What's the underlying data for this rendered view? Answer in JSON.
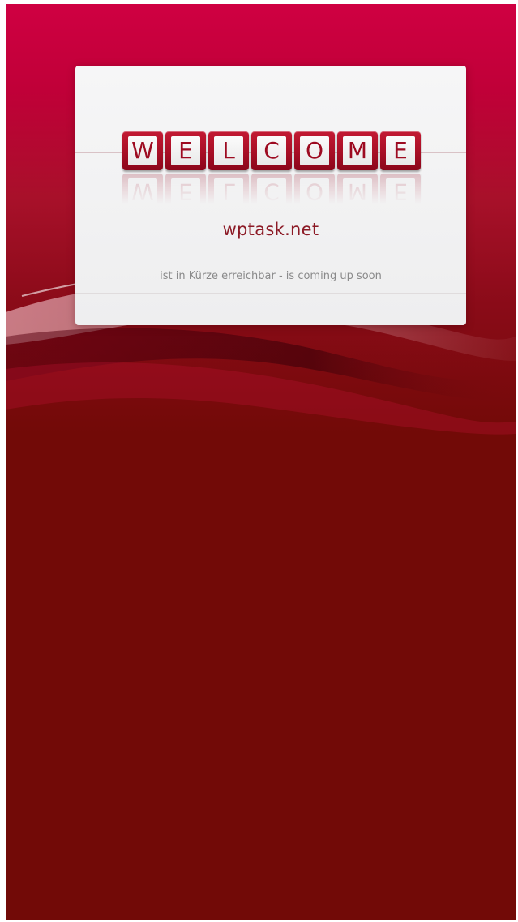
{
  "welcome": {
    "letters": [
      "W",
      "E",
      "L",
      "C",
      "O",
      "M",
      "E"
    ]
  },
  "site": {
    "name": "wptask.net",
    "tagline": "ist in Kürze erreichbar - is coming up soon"
  },
  "colors": {
    "top_background": "#cf0042",
    "bottom_background": "#720a07",
    "tile": "#a70e25",
    "site_name": "#8c1a26"
  }
}
